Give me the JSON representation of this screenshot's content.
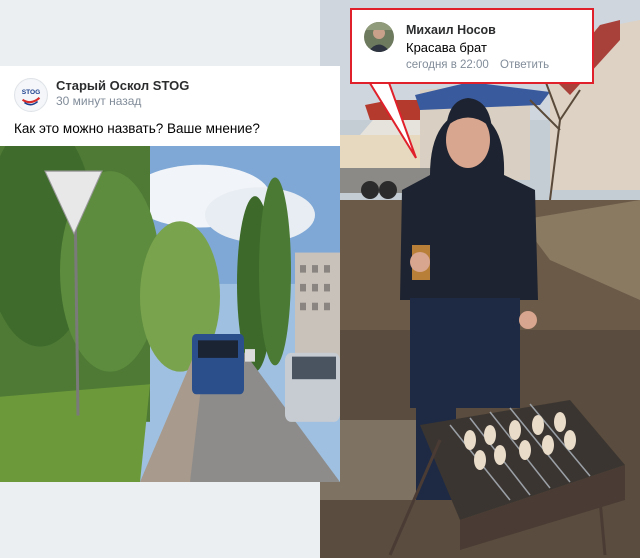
{
  "post": {
    "author": "Старый Оскол STOG",
    "time": "30 минут назад",
    "text": "Как это можно назвать? Ваше мнение?",
    "avatar_text": "STOG"
  },
  "comment": {
    "author": "Михаил Носов",
    "text": "Красава брат",
    "time": "сегодня в 22:00",
    "reply_label": "Ответить"
  },
  "colors": {
    "highlight": "#e0202a",
    "meta_text": "#818c99",
    "card_bg": "#ffffff",
    "page_bg": "#eceff2"
  },
  "icons": {
    "post_avatar": "stog-logo-icon",
    "comment_avatar": "user-avatar-icon"
  }
}
